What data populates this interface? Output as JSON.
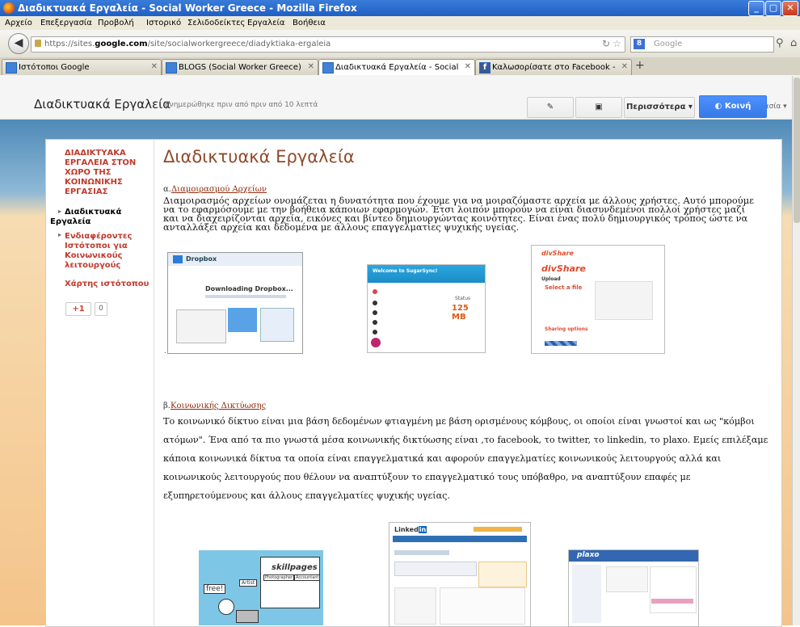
{
  "window": {
    "title": "Διαδικτυακά Εργαλεία - Social Worker Greece - Mozilla Firefox"
  },
  "menu": {
    "items": [
      "Αρχείο",
      "Επεξεργασία",
      "Προβολή",
      "Ιστορικό",
      "Σελιδοδείκτες",
      "Εργαλεία",
      "Βοήθεια"
    ]
  },
  "nav": {
    "url_prefix": "https://sites.",
    "url_domain": "google.com",
    "url_path": "/site/socialworkergreece/diadyktiaka-ergaleia",
    "search_placeholder": "Google"
  },
  "tabs": [
    {
      "label": "Ιστότοποι Google"
    },
    {
      "label": "BLOGS (Social Worker Greece)"
    },
    {
      "label": "Διαδικτυακά Εργαλεία - Social Worker Gr..."
    },
    {
      "label": "Καλωσορίσατε στο Facebook - Συνδεθείτ..."
    }
  ],
  "site_header": {
    "title": "Διαδικτυακά Εργαλεία",
    "updated": "Ενημερώθηκε πριν από πριν από 10 λεπτά",
    "account": "Κοινωνική Εργασία ▾",
    "more_label": "Περισσότερα ▾",
    "share_label": "Κοινή χρήση"
  },
  "sidebar": {
    "link1": [
      "ΔΙΑΔΙΚΤΥΑΚΑ",
      "ΕΡΓΑΛΕΙΑ ΣΤΟΝ",
      "ΧΩΡΟ ΤΗΣ",
      "ΚΟΙΝΩΝΙΚΗΣ",
      "ΕΡΓΑΣΙΑΣ"
    ],
    "current": [
      "Διαδικτυακά",
      "Εργαλεία"
    ],
    "link2": [
      "Ενδιαφέροντες",
      "Ιστότοποι για",
      "Κοινωνικούς",
      "λειτουργούς"
    ],
    "link3": "Χάρτης ιστότοπου",
    "gplus": "+1",
    "gplus_count": "0"
  },
  "main": {
    "title": "Διαδικτυακά Εργαλεία",
    "section1_prefix": "α.",
    "section1_link": "Διαμοιρασμού Αρχείων",
    "section1_text": "Διαμοιρασμός αρχείων ονομάζεται η δυνατότητα που έχουμε για να μοιραζόμαστε αρχεία με άλλους χρήστες. Αυτό μπορούμε να το εφαρμόσουμε με την βοήθεια κάποιων εφαρμογών. Έτσι λοιπόν μπορούν να είναι διασυνδεμένοι πολλοί χρήστες μαζί και να διαχειρίζονται αρχεία, εικόνες και βίντεο δημιουργώντας κοινότητες. Είναι ένας πολύ δημιουργικός τρόπος ώστε να ανταλλάξει αρχεία και δεδομένα με άλλους επαγγελματίες ψυχικής υγείας.",
    "section2_prefix": "β.",
    "section2_link": "Κοινωνικής Δικτύωσης",
    "section2_text": "Το κοινωνικό δίκτυο είναι μια βάση δεδομένων φτιαγμένη με βάση ορισμένους κόμβους, οι οποίοι είναι γνωστοί και ως \"κόμβοι ατόμων\". Ένα από τα πιο γνωστά μέσα κοινωνικής δικτύωσης είναι ,το facebook, το twitter, το linkedin, το plaxo. Εμείς επιλέξαμε κάποια κοινωνικά δίκτυα τα οποία είναι  επαγγελματικά και αφορούν επαγγελματίες κοινωνικούς λειτουργούς αλλά και κοινωνικούς λειτουργούς που θέλουν να αναπτύξουν το επαγγελματικό τους υπόβαθρο, να αναπτύξουν επαφές  με εξυπηρετούμενους και άλλους επαγγελματίες ψυχικής υγείας."
  },
  "thumbs": {
    "dropbox": {
      "brand": "Dropbox",
      "text": "Downloading Dropbox..."
    },
    "sugarsync": {
      "heading": "Welcome to SugarSync!",
      "status": "Status",
      "size": "125 MB"
    },
    "divshare": {
      "brand": "divShare",
      "upload": "Upload",
      "select": "Select a file",
      "options": "Sharing options"
    },
    "skillpages": {
      "brand": "skillpages",
      "free": "free!",
      "artist": "Artist",
      "photographer": "Photographer",
      "accountant": "Accountant"
    },
    "linkedin": {
      "brand": "Linked",
      "in": "in"
    },
    "plaxo": {
      "brand": "plaxo"
    }
  },
  "colors": {
    "accent_link": "#c0392b",
    "title_brown": "#8e4a2a",
    "share_blue": "#4d90fe"
  }
}
